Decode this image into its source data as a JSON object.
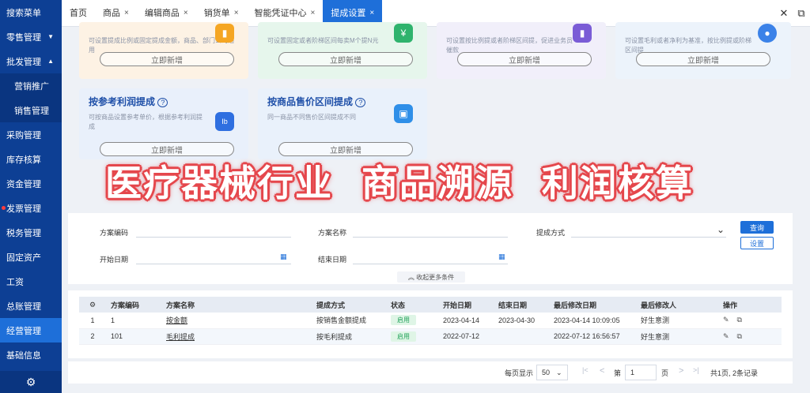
{
  "sidebar": {
    "items": [
      {
        "label": "搜索菜单"
      },
      {
        "label": "零售管理",
        "arrow": "▼"
      },
      {
        "label": "批发管理",
        "arrow": "▲"
      },
      {
        "label": "营销推广"
      },
      {
        "label": "销售管理"
      },
      {
        "label": "采购管理"
      },
      {
        "label": "库存核算"
      },
      {
        "label": "资金管理"
      },
      {
        "label": "发票管理"
      },
      {
        "label": "税务管理"
      },
      {
        "label": "固定资产"
      },
      {
        "label": "工资"
      },
      {
        "label": "总账管理"
      },
      {
        "label": "经营管理"
      },
      {
        "label": "基础信息"
      }
    ],
    "gear_icon": "⚙"
  },
  "tabs": [
    {
      "label": "首页"
    },
    {
      "label": "商品",
      "close": "×"
    },
    {
      "label": "编辑商品",
      "close": "×"
    },
    {
      "label": "销货单",
      "close": "×"
    },
    {
      "label": "智能凭证中心",
      "close": "×"
    },
    {
      "label": "提成设置",
      "close": "×"
    }
  ],
  "window": {
    "close": "✕",
    "restore": "⧉"
  },
  "cards": [
    {
      "desc": "可设置提成比例或固定提成金额，商品、部门公司通用",
      "add": "立即新增",
      "icon": "▮",
      "color": "#f5a623"
    },
    {
      "desc": "可设置固定或者阶梯区间每卖M个提N元",
      "add": "立即新增",
      "icon": "¥",
      "color": "#2fb36d"
    },
    {
      "desc": "可设置按比例提或者阶梯区间提，促进业务员催款",
      "add": "立即新增",
      "icon": "▮",
      "color": "#7a5cd6"
    },
    {
      "desc": "可设置毛利或者净利为基准，按比例提或阶梯区间提",
      "add": "立即新增",
      "icon": "●",
      "color": "#3b82e8"
    },
    {
      "title": "按参考利润提成",
      "help": "?",
      "desc": "可按商品设置参考单价，根据参考利润提成",
      "add": "立即新增",
      "icon": "Ib",
      "color": "#2f6fe0"
    },
    {
      "title": "按商品售价区间提成",
      "help": "?",
      "desc": "同一商品不同售价区间提成不同",
      "add": "立即新增",
      "icon": "▣",
      "color": "#2f8fe8"
    }
  ],
  "banner": {
    "part1": "医疗器械行业",
    "part2": "商品溯源",
    "part3": "利润核算"
  },
  "search": {
    "scheme_code_label": "方案编码",
    "scheme_name_label": "方案名称",
    "method_label": "提成方式",
    "start_label": "开始日期",
    "end_label": "结束日期",
    "query_btn": "查询",
    "settings_btn": "设置",
    "collapse": "︽ 收起更多条件",
    "calendar_icon": "▦",
    "dropdown_icon": "⌄"
  },
  "table": {
    "headers": [
      "⚙",
      "方案编码",
      "方案名称",
      "提成方式",
      "状态",
      "开始日期",
      "结束日期",
      "最后修改日期",
      "最后修改人",
      "操作"
    ],
    "rows": [
      {
        "idx": "1",
        "code": "1",
        "name": "按金额",
        "method": "按销售金额提成",
        "status": "启用",
        "start": "2023-04-14",
        "end": "2023-04-30",
        "modified": "2023-04-14 10:09:05",
        "modifier": "好生意测",
        "op_edit": "✎",
        "op_copy": "⧉"
      },
      {
        "idx": "2",
        "code": "101",
        "name": "毛利提成",
        "method": "按毛利提成",
        "status": "启用",
        "start": "2022-07-12",
        "end": "",
        "modified": "2022-07-12 16:56:57",
        "modifier": "好生意测",
        "op_edit": "✎",
        "op_copy": "⧉"
      }
    ]
  },
  "pager": {
    "per_page_label": "每页显示",
    "per_page": "50",
    "first": "|<",
    "prev": "<",
    "page_prefix": "第",
    "page": "1",
    "page_suffix": "页",
    "next": ">",
    "last": ">|",
    "summary": "共1页, 2条记录"
  }
}
